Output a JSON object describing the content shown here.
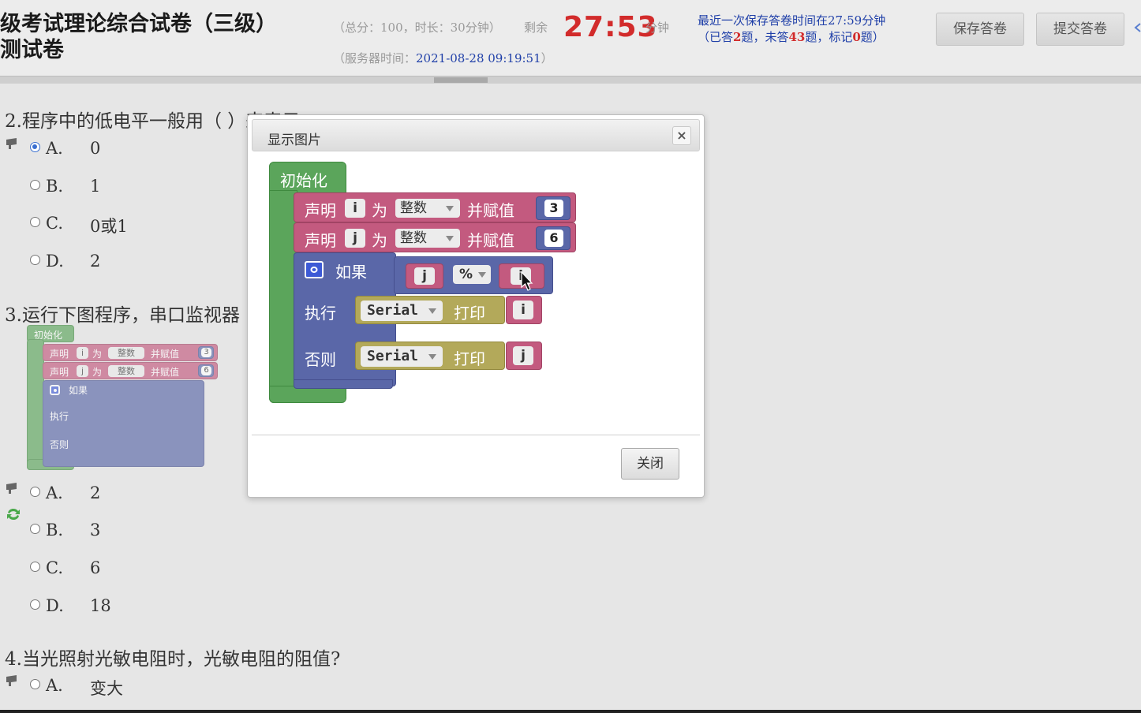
{
  "header": {
    "title_line1": "级考试理论综合试卷（三级）",
    "title_line2": "测试卷",
    "exam_info": "（总分：100，时长：30分钟）",
    "remaining_label": "剩余",
    "timer": "27:53",
    "minute_label": "分钟",
    "server_time_label": "（服务器时间：",
    "server_time_value": "2021-08-28 09:19:51",
    "server_time_close": "）",
    "save_line1": "最近一次保存答卷时间在27:59分钟",
    "save_line2_a": "（已答",
    "save_answered": "2",
    "save_line2_b": "题，未答",
    "save_unanswered": "43",
    "save_line2_c": "题，标记",
    "save_marked": "0",
    "save_line2_d": "题）",
    "save_button": "保存答卷",
    "submit_button": "提交答卷",
    "accent_color": "#d22b2b",
    "link_color": "#1f3fa8"
  },
  "questions": [
    {
      "stem": "2.程序中的低电平一般用（ ）来表示",
      "options": [
        {
          "letter": "A.",
          "text": "0",
          "selected": true
        },
        {
          "letter": "B.",
          "text": "1",
          "selected": false
        },
        {
          "letter": "C.",
          "text": "0或1",
          "selected": false
        },
        {
          "letter": "D.",
          "text": "2",
          "selected": false
        }
      ]
    },
    {
      "stem": "3.运行下图程序，串口监视器",
      "options": [
        {
          "letter": "A.",
          "text": "2",
          "selected": false
        },
        {
          "letter": "B.",
          "text": "3",
          "selected": false
        },
        {
          "letter": "C.",
          "text": "6",
          "selected": false
        },
        {
          "letter": "D.",
          "text": "18",
          "selected": false
        }
      ]
    },
    {
      "stem": "4.当光照射光敏电阻时，光敏电阻的阻值?",
      "options": [
        {
          "letter": "A.",
          "text": "变大",
          "selected": false
        }
      ]
    }
  ],
  "program": {
    "init": "初始化",
    "declare": "声明",
    "as": "为",
    "type": "整数",
    "assign": "并赋值",
    "var_i": "i",
    "var_j": "j",
    "val_i": "3",
    "val_j": "6",
    "if": "如果",
    "mod_op": "%",
    "then": "执行",
    "else": "否则",
    "serial": "Serial",
    "print": "打印",
    "colors": {
      "init": "#5ba55b",
      "declare": "#c35a7f",
      "logic": "#5a67a8",
      "serial": "#b3a95a"
    }
  },
  "modal": {
    "title": "显示图片",
    "close_x": "×",
    "close_button": "关闭"
  }
}
